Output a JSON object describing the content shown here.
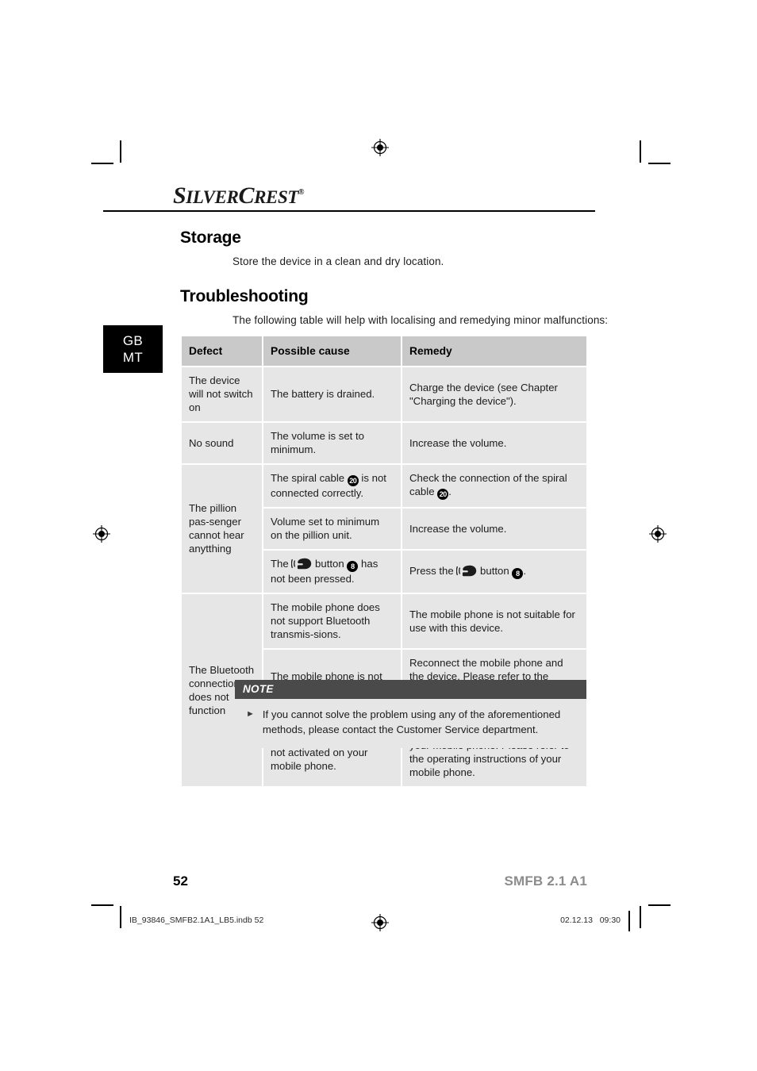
{
  "brand": {
    "logo_part1": "S",
    "logo_part2": "ILVER",
    "logo_part3": "C",
    "logo_part4": "REST",
    "registered_mark": "®"
  },
  "country_tab": {
    "line1": "GB",
    "line2": "MT"
  },
  "sections": {
    "storage": {
      "heading": "Storage",
      "body": "Store the device in a clean and dry location."
    },
    "troubleshooting": {
      "heading": "Troubleshooting",
      "intro": "The following table will help with localising and remedying minor malfunctions:"
    }
  },
  "table": {
    "headers": {
      "defect": "Defect",
      "cause": "Possible cause",
      "remedy": "Remedy"
    },
    "rows": [
      {
        "defect": "The device will not switch on",
        "cause": "The battery is drained.",
        "remedy": "Charge the device (see Chapter \"Charging the device\")."
      },
      {
        "defect": "No sound",
        "cause": "The volume is set to minimum.",
        "remedy": "Increase the volume."
      },
      {
        "defect": "The pillion pas-senger cannot hear anytthing",
        "cause_pre": "The spiral cable ",
        "cause_badge": "20",
        "cause_post": " is not connected correctly.",
        "remedy_pre": "Check the connection of the spiral cable ",
        "remedy_badge": "20",
        "remedy_post": "."
      },
      {
        "cause": "Volume set to minimum on the pillion unit.",
        "remedy": "Increase the volume."
      },
      {
        "cause_pre": "The ",
        "cause_mid": " button ",
        "cause_badge": "8",
        "cause_post": " has not been pressed.",
        "remedy_pre": "Press the ",
        "remedy_mid": " button ",
        "remedy_badge": "8",
        "remedy_post": "."
      },
      {
        "defect": "The Bluetooth connection does not function",
        "cause": "The mobile phone does not support Bluetooth transmis-sions.",
        "remedy": "The mobile phone is not suitable for use with this device."
      },
      {
        "cause": "The mobile phone is not paired with the device.",
        "remedy": "Reconnect the mobile phone and the device. Please refer to the operating instructions of your mobile phone."
      },
      {
        "cause": "Bluetooth transmission is not activated on your mobile phone.",
        "remedy": "Switch on Bluetooth transmission on your mobile phone. Please refer to the operating instructions of your mobile phone."
      }
    ]
  },
  "note": {
    "title": "NOTE",
    "bullet": "►",
    "text": "If you cannot solve the problem using any of the aforementioned methods, please contact the Customer Service department."
  },
  "footer": {
    "page_number": "52",
    "model": "SMFB 2.1 A1",
    "print_file": "IB_93846_SMFB2.1A1_LB5.indb   52",
    "print_date": "02.12.13   09:30"
  },
  "colors": {
    "table_header_bg": "#c9c9c9",
    "table_cell_bg": "#e6e6e6",
    "note_header_bg": "#4a4a4a",
    "country_tab_bg": "#000000",
    "model_gray": "#8c8c8c"
  }
}
